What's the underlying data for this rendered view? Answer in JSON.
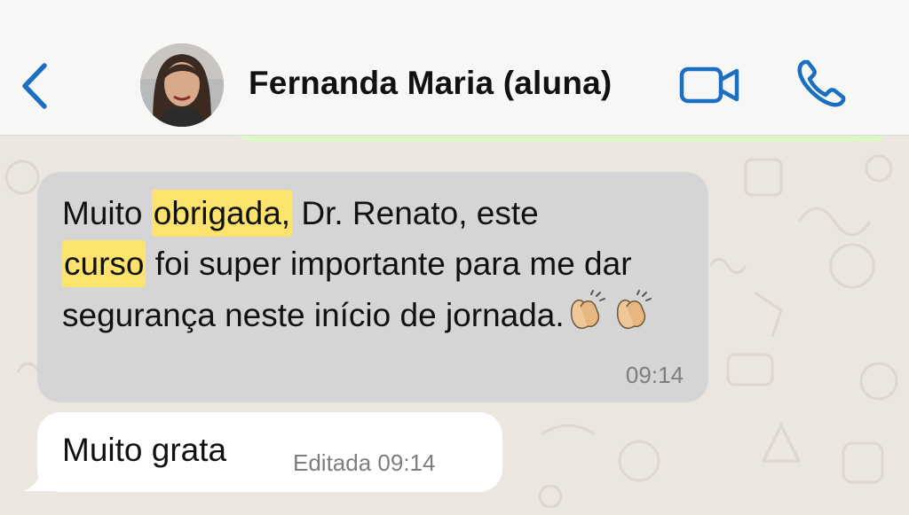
{
  "header": {
    "back_icon": "chevron-left-icon",
    "contact_name": "Fernanda Maria (aluna)",
    "video_icon": "video-camera-icon",
    "call_icon": "phone-icon"
  },
  "messages": [
    {
      "direction": "incoming",
      "parts": {
        "p1": "Muito ",
        "h1": "obrigada,",
        "p2": "  Dr. Renato, este ",
        "h2": "curso",
        "p3": " foi super importante para me dar segurança neste início de jornada."
      },
      "emoji": [
        "clapping-hands",
        "clapping-hands"
      ],
      "time": "09:14"
    },
    {
      "direction": "incoming",
      "text": "Muito grata",
      "time": "Editada 09:14"
    }
  ],
  "colors": {
    "accent_blue": "#1b6fc2",
    "incoming_bubble_highlighted": "#d5d5d5",
    "incoming_bubble": "#ffffff",
    "outgoing_bubble": "#dbf8c6",
    "highlight": "#fbe36e"
  }
}
